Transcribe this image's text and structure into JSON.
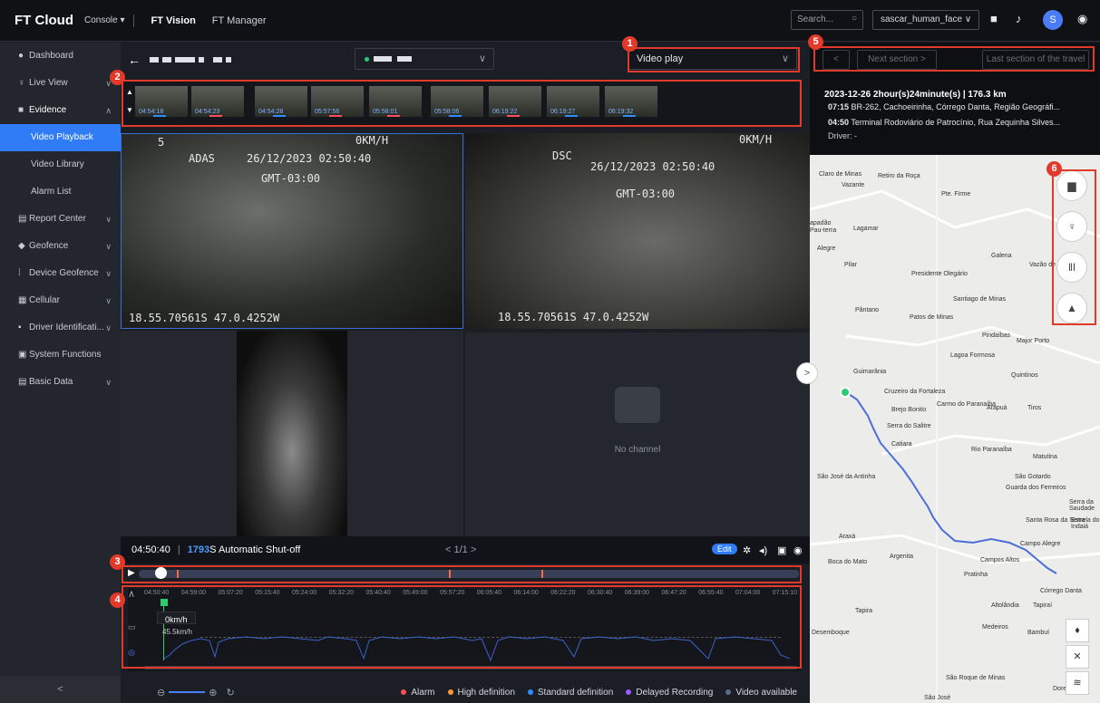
{
  "topbar": {
    "logo": "FT Cloud",
    "console": "Console ▾",
    "nav": [
      "FT Vision",
      "FT Manager"
    ],
    "search_placeholder": "Search...",
    "org": "sascar_human_face ∨",
    "avatar": "S"
  },
  "sidebar": {
    "items": [
      {
        "label": "Dashboard"
      },
      {
        "label": "Live View"
      },
      {
        "label": "Evidence"
      },
      {
        "label": "Video Playback"
      },
      {
        "label": "Video Library"
      },
      {
        "label": "Alarm List"
      },
      {
        "label": "Report Center"
      },
      {
        "label": "Geofence"
      },
      {
        "label": "Device Geofence"
      },
      {
        "label": "Cellular"
      },
      {
        "label": "Driver Identificati..."
      },
      {
        "label": "System Functions"
      },
      {
        "label": "Basic Data"
      }
    ],
    "collapse": "<"
  },
  "main": {
    "play_mode": "Video play",
    "thumbnails": [
      "04:54:18",
      "04:54:23",
      "04:54:28",
      "05:57:56",
      "05:58:01",
      "05:58:06",
      "06:19:22",
      "06:19:27",
      "06:19:32"
    ],
    "videos": [
      {
        "tag": "ADAS",
        "date": "26/12/2023 02:50:40",
        "tz": "GMT-03:00",
        "speed": "0KM/H",
        "coords": "18.55.70561S 47.0.4252W",
        "num": "5"
      },
      {
        "tag": "DSC",
        "date": "26/12/2023 02:50:40",
        "tz": "GMT-03:00",
        "speed": "0KM/H",
        "coords": "18.55.70561S 47.0.4252W"
      }
    ],
    "no_channel": "No channel",
    "time": "04:50:40",
    "shutoff_count": "1793",
    "shutoff_text": "S Automatic Shut-off",
    "page": "< 1/1 >",
    "edit": "Edit",
    "timeline_ticks": [
      "04:50:40",
      "04:59:00",
      "05:07:20",
      "05:15:40",
      "05:24:00",
      "05:32:20",
      "05:40:40",
      "05:49:00",
      "05:57:20",
      "06:05:40",
      "06:14:00",
      "06:22:20",
      "06:30:40",
      "06:39:00",
      "06:47:20",
      "06:55:40",
      "07:04:00",
      "07:15:10"
    ],
    "speed_now": "0km/h",
    "speed_ref": "45.5km/h",
    "legend": [
      {
        "label": "Alarm",
        "color": "#ff4d5b"
      },
      {
        "label": "High definition",
        "color": "#ff9a3c"
      },
      {
        "label": "Standard definition",
        "color": "#2f8cff"
      },
      {
        "label": "Delayed Recording",
        "color": "#9a5cff"
      },
      {
        "label": "Video available",
        "color": "#5b6b8c"
      }
    ]
  },
  "right": {
    "prev": "<",
    "next_section": "Next section >",
    "last_section": "Last section of the travel",
    "trip_summary": "2023-12-26  2hour(s)24minute(s) | 176.3 km",
    "end_time": "07:15",
    "end_addr": "BR-262, Cachoeirinha, Córrego Danta, Região Geográfi...",
    "start_time": "04:50",
    "start_addr": "Terminal Rodoviário de Patrocínio, Rua Zequinha Silves...",
    "driver": "Driver: -"
  },
  "map_labels": [
    "Claro de Minas",
    "Retiro da Roça",
    "Vazante",
    "Pte. Firme",
    "apadão",
    "Pau-terra",
    "Lagamar",
    "Alegre",
    "Galena",
    "Vazão de Minas",
    "Pilar",
    "Presidente Olegário",
    "Santiago de Minas",
    "Pântano",
    "Patos de Minas",
    "Pindaíbas",
    "Major Porto",
    "Lagoa Formosa",
    "Guimarânia",
    "Quintinos",
    "Cruzeiro da Fortaleza",
    "Carmo do Paranaíba",
    "Arapuá",
    "Tiros",
    "Brejo Bonito",
    "Serra do Salitre",
    "Catiara",
    "Rio Paranaíba",
    "Matutina",
    "São José da Antinha",
    "São Gotardo",
    "Guarda dos Ferreiros",
    "Santa Rosa da Serra",
    "Serra da Saudade",
    "Estrela do Indaiá",
    "Araxá",
    "Campo Alegre",
    "Boca do Mato",
    "Argenita",
    "Campos Altos",
    "Pratinha",
    "Córrego Danta",
    "Tapira",
    "Altolândia",
    "Tapiraí",
    "Desemboque",
    "Medeiros",
    "Bambuí",
    "São Roque de Minas",
    "Doresópolis",
    "São José"
  ],
  "callouts": [
    "1",
    "2",
    "3",
    "4",
    "5",
    "6"
  ]
}
